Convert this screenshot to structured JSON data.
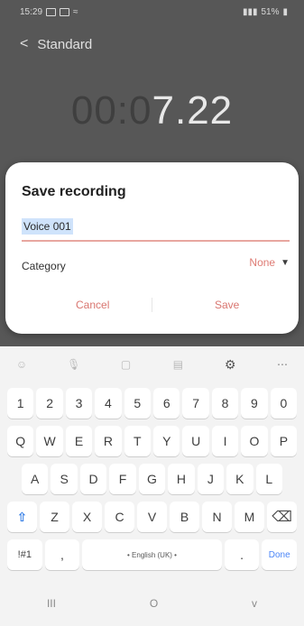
{
  "status_bar": {
    "time": "15:29",
    "left_icons": [
      "gallery-icon",
      "card-icon",
      "notification-icon"
    ],
    "right_text": "51%"
  },
  "header": {
    "back_symbol": "<",
    "title": "Standard"
  },
  "timer": {
    "dim": "00:0",
    "bright": "7.22"
  },
  "dialog": {
    "title": "Save recording",
    "name_value": "Voice 001",
    "category_label": "Category",
    "category_value": "None",
    "cancel_label": "Cancel",
    "save_label": "Save"
  },
  "keyboard": {
    "toolbar_icons": [
      "emoji-icon",
      "voice-icon",
      "sticker-icon",
      "clipboard-icon",
      "gear-icon",
      "more-icon"
    ],
    "row_numbers": [
      "1",
      "2",
      "3",
      "4",
      "5",
      "6",
      "7",
      "8",
      "9",
      "0"
    ],
    "row_q": [
      "Q",
      "W",
      "E",
      "R",
      "T",
      "Y",
      "U",
      "I",
      "O",
      "P"
    ],
    "row_a": [
      "A",
      "S",
      "D",
      "F",
      "G",
      "H",
      "J",
      "K",
      "L"
    ],
    "row_z": [
      "Z",
      "X",
      "C",
      "V",
      "B",
      "N",
      "M"
    ],
    "symbols_label": "!#1",
    "comma": ",",
    "space_label": "• English (UK) •",
    "period": ".",
    "done_label": "Done"
  },
  "nav": {
    "recents": "III",
    "home": "O",
    "back": "v"
  },
  "colors": {
    "accent": "#de7b74",
    "selection": "#cfe3fb",
    "blue": "#4c86f7"
  }
}
